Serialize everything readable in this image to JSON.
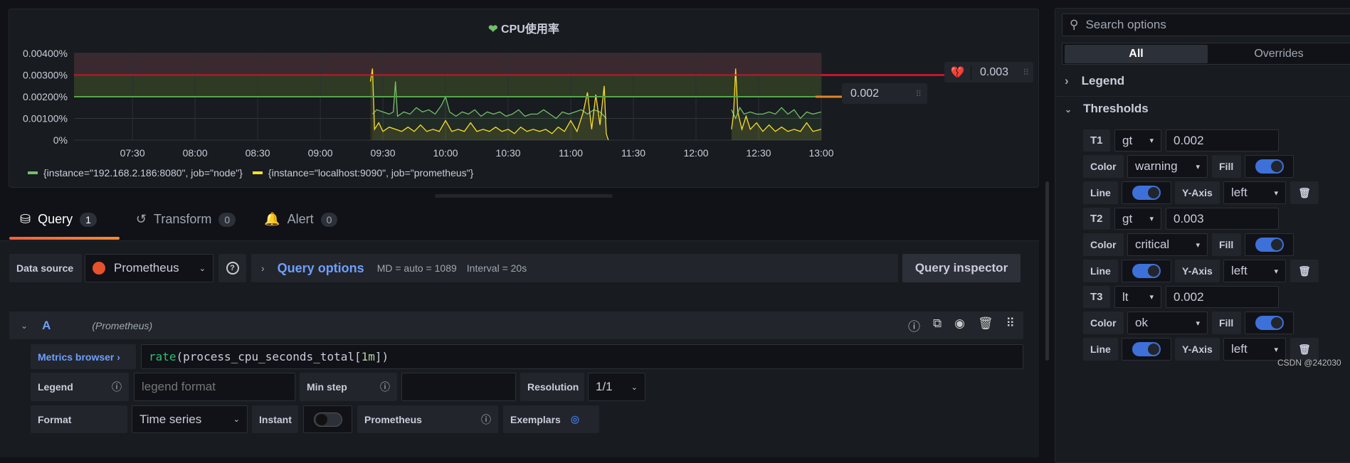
{
  "panel": {
    "title": "CPU使用率",
    "title_icon": "heart-icon"
  },
  "chart_data": {
    "type": "line",
    "title": "CPU使用率",
    "xlim": [
      "07:02",
      "13:00"
    ],
    "ylim": [
      0,
      0.004
    ],
    "y_ticks": [
      "0%",
      "0.00100%",
      "0.00200%",
      "0.00300%",
      "0.00400%"
    ],
    "x_ticks": [
      "07:30",
      "08:00",
      "08:30",
      "09:00",
      "09:30",
      "10:00",
      "10:30",
      "11:00",
      "11:30",
      "12:00",
      "12:30",
      "13:00"
    ],
    "grid": true,
    "legend_placement": "bottom-left",
    "thresholds": [
      {
        "value": 0.003,
        "color": "#c4162a",
        "fill": "#3a2a30"
      },
      {
        "value": 0.002,
        "color": "#56a64b",
        "fill": "#2e3a24"
      }
    ],
    "series": [
      {
        "name": "{instance=\"192.168.2.186:8080\", job=\"node\"}",
        "color": "#73bf69",
        "segments": [
          [
            [
              "09:25",
              0.0012
            ],
            [
              "09:27",
              0.0014
            ],
            [
              "09:30",
              0.0013
            ],
            [
              "09:33",
              0.0012
            ],
            [
              "09:35",
              0.0013
            ],
            [
              "09:36",
              0.0027
            ],
            [
              "09:37",
              0.0011
            ],
            [
              "09:40",
              0.0013
            ],
            [
              "09:43",
              0.0012
            ],
            [
              "09:46",
              0.0015
            ],
            [
              "09:49",
              0.0013
            ],
            [
              "09:52",
              0.0014
            ],
            [
              "09:55",
              0.0012
            ],
            [
              "09:58",
              0.0016
            ],
            [
              "10:00",
              0.002
            ],
            [
              "10:02",
              0.0013
            ],
            [
              "10:05",
              0.0011
            ],
            [
              "10:08",
              0.0013
            ],
            [
              "10:11",
              0.0012
            ],
            [
              "10:14",
              0.0014
            ],
            [
              "10:17",
              0.0011
            ],
            [
              "10:20",
              0.0013
            ],
            [
              "10:23",
              0.0012
            ],
            [
              "10:26",
              0.0013
            ],
            [
              "10:29",
              0.0011
            ],
            [
              "10:32",
              0.0012
            ],
            [
              "10:35",
              0.0014
            ],
            [
              "10:38",
              0.0011
            ],
            [
              "10:41",
              0.0012
            ],
            [
              "10:44",
              0.0012
            ],
            [
              "10:47",
              0.0014
            ],
            [
              "10:50",
              0.0012
            ],
            [
              "10:53",
              0.001
            ],
            [
              "10:56",
              0.0013
            ],
            [
              "10:59",
              0.0012
            ],
            [
              "11:02",
              0.0013
            ],
            [
              "11:05",
              0.0014
            ],
            [
              "11:08",
              0.0012
            ],
            [
              "11:11",
              0.0014
            ],
            [
              "11:14",
              0.0013
            ],
            [
              "11:17",
              0.001
            ]
          ],
          [
            [
              "12:17",
              0.0014
            ],
            [
              "12:19",
              0.001
            ],
            [
              "12:21",
              0.0015
            ],
            [
              "12:23",
              0.0012
            ],
            [
              "12:26",
              0.0013
            ],
            [
              "12:29",
              0.0012
            ],
            [
              "12:32",
              0.0012
            ],
            [
              "12:35",
              0.0013
            ],
            [
              "12:38",
              0.0012
            ],
            [
              "12:41",
              0.0015
            ],
            [
              "12:44",
              0.0012
            ],
            [
              "12:47",
              0.0014
            ],
            [
              "12:50",
              0.001
            ],
            [
              "12:53",
              0.0013
            ],
            [
              "12:56",
              0.0012
            ],
            [
              "13:00",
              0.0013
            ]
          ]
        ]
      },
      {
        "name": "{instance=\"localhost:9090\", job=\"prometheus\"}",
        "color": "#fade2a",
        "segments": [
          [
            [
              "09:24",
              0.0027
            ],
            [
              "09:25",
              0.0033
            ],
            [
              "09:26",
              0.0005
            ],
            [
              "09:28",
              0.0008
            ],
            [
              "09:30",
              0.0004
            ],
            [
              "09:33",
              0.0006
            ],
            [
              "09:36",
              0.0005
            ],
            [
              "09:39",
              0.0004
            ],
            [
              "09:42",
              0.0006
            ],
            [
              "09:45",
              0.0004
            ],
            [
              "09:48",
              0.0007
            ],
            [
              "09:51",
              0.0004
            ],
            [
              "09:54",
              0.0005
            ],
            [
              "09:57",
              0.0004
            ],
            [
              "10:00",
              0.0009
            ],
            [
              "10:03",
              0.0004
            ],
            [
              "10:06",
              0.0005
            ],
            [
              "10:09",
              0.0004
            ],
            [
              "10:12",
              0.0008
            ],
            [
              "10:15",
              0.0004
            ],
            [
              "10:18",
              0.0005
            ],
            [
              "10:21",
              0.0004
            ],
            [
              "10:24",
              0.0006
            ],
            [
              "10:27",
              0.0004
            ],
            [
              "10:30",
              0.0005
            ],
            [
              "10:33",
              0.0003
            ],
            [
              "10:36",
              0.0006
            ],
            [
              "10:39",
              0.0004
            ],
            [
              "10:42",
              0.0005
            ],
            [
              "10:45",
              0.0004
            ],
            [
              "10:48",
              0.0005
            ],
            [
              "10:51",
              0.0003
            ],
            [
              "10:54",
              0.0006
            ],
            [
              "10:57",
              0.0004
            ],
            [
              "11:00",
              0.0009
            ],
            [
              "11:03",
              0.0004
            ],
            [
              "11:06",
              0.0013
            ],
            [
              "11:08",
              0.0022
            ],
            [
              "11:10",
              0.0005
            ],
            [
              "11:12",
              0.0021
            ],
            [
              "11:14",
              0.0007
            ],
            [
              "11:16",
              0.0025
            ],
            [
              "11:17",
              0.0003
            ],
            [
              "11:18",
              0
            ]
          ],
          [
            [
              "12:17",
              0.0005
            ],
            [
              "12:18",
              0.0012
            ],
            [
              "12:19",
              0.0033
            ],
            [
              "12:20",
              0.0013
            ],
            [
              "12:22",
              0.0005
            ],
            [
              "12:24",
              0.0011
            ],
            [
              "12:26",
              0.0005
            ],
            [
              "12:29",
              0.0008
            ],
            [
              "12:32",
              0.0004
            ],
            [
              "12:35",
              0.0007
            ],
            [
              "12:38",
              0.0004
            ],
            [
              "12:41",
              0.0006
            ],
            [
              "12:44",
              0.0004
            ],
            [
              "12:47",
              0.0005
            ],
            [
              "12:50",
              0.0004
            ],
            [
              "12:53",
              0.0008
            ],
            [
              "12:56",
              0.0004
            ],
            [
              "13:00",
              0.0005
            ]
          ]
        ]
      }
    ]
  },
  "threshold_handles": [
    {
      "value": "0.003",
      "icon": "broken-heart-icon"
    },
    {
      "value": "0.002"
    }
  ],
  "tabs": [
    {
      "label": "Query",
      "count": "1",
      "icon": "database-icon"
    },
    {
      "label": "Transform",
      "count": "0",
      "icon": "transform-icon"
    },
    {
      "label": "Alert",
      "count": "0",
      "icon": "bell-icon"
    }
  ],
  "query_bar": {
    "datasource_label": "Data source",
    "datasource": "Prometheus",
    "query_options": "Query options",
    "md": "MD = auto = 1089",
    "interval": "Interval = 20s",
    "inspector": "Query inspector"
  },
  "query_row": {
    "ref": "A",
    "ds": "(Prometheus)",
    "metrics_browser": "Metrics browser",
    "expr_fn": "rate",
    "expr_open": "(process_cpu_seconds_total[",
    "expr_range": "1m",
    "expr_close": "])",
    "legend_label": "Legend",
    "legend_placeholder": "legend format",
    "min_step": "Min step",
    "resolution": "Resolution",
    "resolution_value": "1/1",
    "format_label": "Format",
    "format_value": "Time series",
    "instant": "Instant",
    "type": "Prometheus",
    "exemplars": "Exemplars"
  },
  "options": {
    "search_placeholder": "Search options",
    "tab_all": "All",
    "tab_overrides": "Overrides",
    "legend": "Legend",
    "thresholds": "Thresholds",
    "color_label": "Color",
    "fill_label": "Fill",
    "line_label": "Line",
    "yaxis_label": "Y-Axis",
    "items": [
      {
        "name": "T1",
        "op": "gt",
        "value": "0.002",
        "color": "warning",
        "fill": true,
        "line": true,
        "yaxis": "left"
      },
      {
        "name": "T2",
        "op": "gt",
        "value": "0.003",
        "color": "critical",
        "fill": true,
        "line": true,
        "yaxis": "left"
      },
      {
        "name": "T3",
        "op": "lt",
        "value": "0.002",
        "color": "ok",
        "fill": true,
        "line": true,
        "yaxis": "left"
      }
    ]
  },
  "watermark": "CSDN @242030"
}
